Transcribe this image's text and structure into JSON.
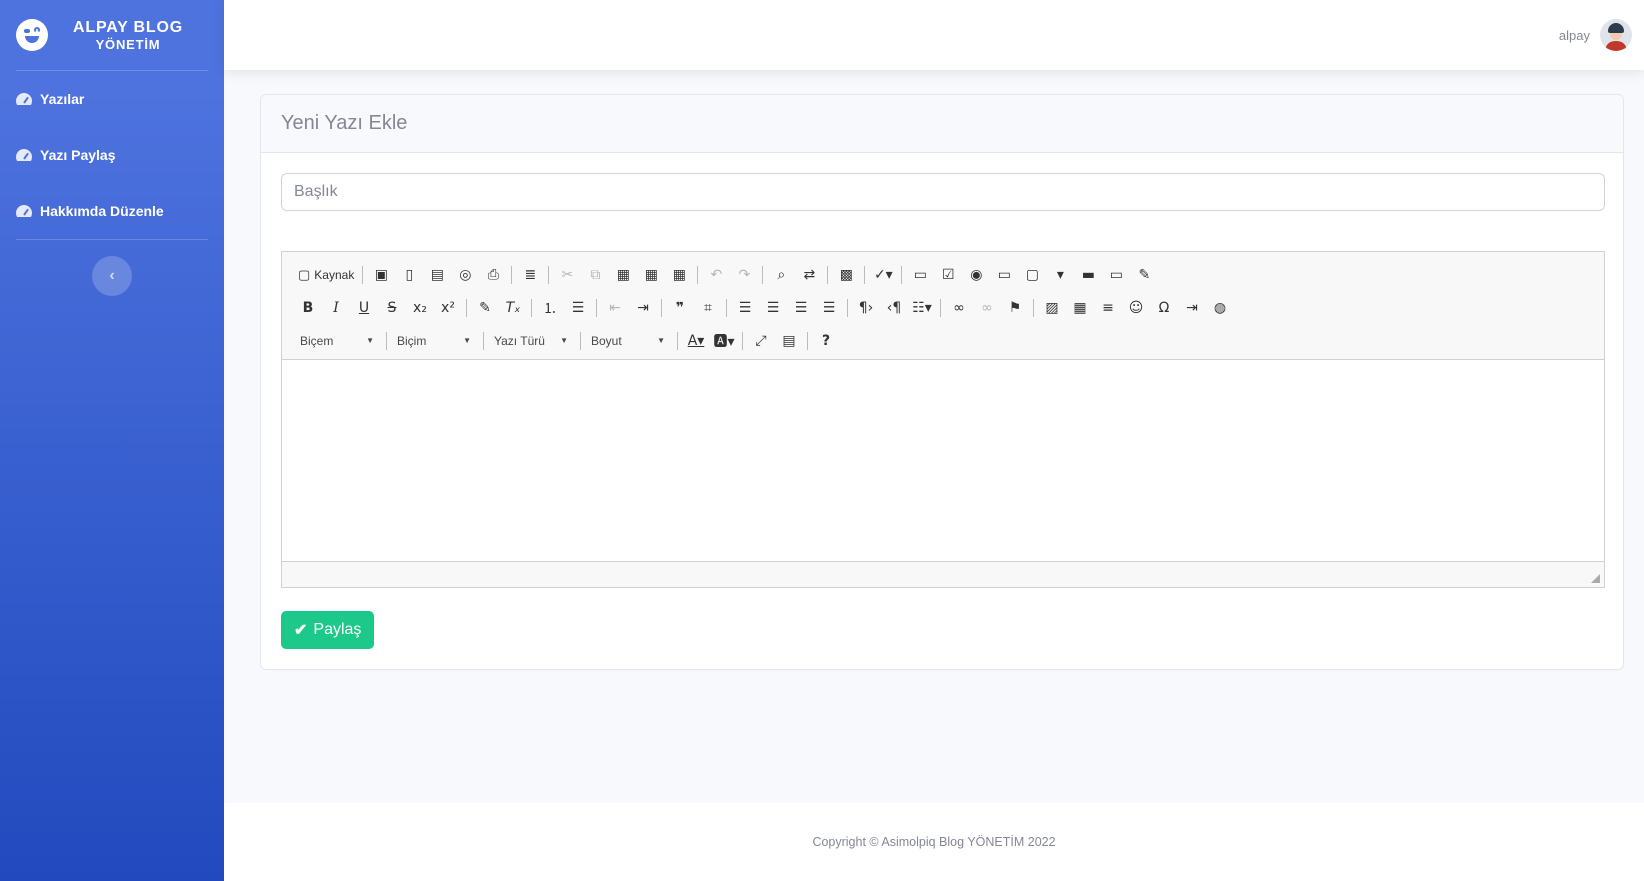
{
  "sidebar": {
    "brand": {
      "line1": "ALPAY BLOG",
      "line2": "YÖNETİM"
    },
    "items": [
      {
        "label": "Yazılar",
        "icon": "tachometer-icon"
      },
      {
        "label": "Yazı Paylaş",
        "icon": "tachometer-icon"
      },
      {
        "label": "Hakkımda Düzenle",
        "icon": "tachometer-icon"
      }
    ],
    "toggle_glyph": "‹"
  },
  "topbar": {
    "user_name": "alpay"
  },
  "card": {
    "title": "Yeni Yazı Ekle",
    "title_placeholder": "Başlık",
    "submit_label": "Paylaş"
  },
  "editor": {
    "source_label": "Kaynak",
    "combos": {
      "styles": "Biçem",
      "format": "Biçim",
      "font": "Yazı Türü",
      "size": "Boyut"
    },
    "content": ""
  },
  "footer": {
    "copyright": "Copyright © Asimolpiq Blog YÖNETİM 2022"
  },
  "colors": {
    "sidebar_top": "#4e73df",
    "sidebar_bottom": "#224abe",
    "success": "#1cc88a",
    "text_muted": "#858796"
  }
}
